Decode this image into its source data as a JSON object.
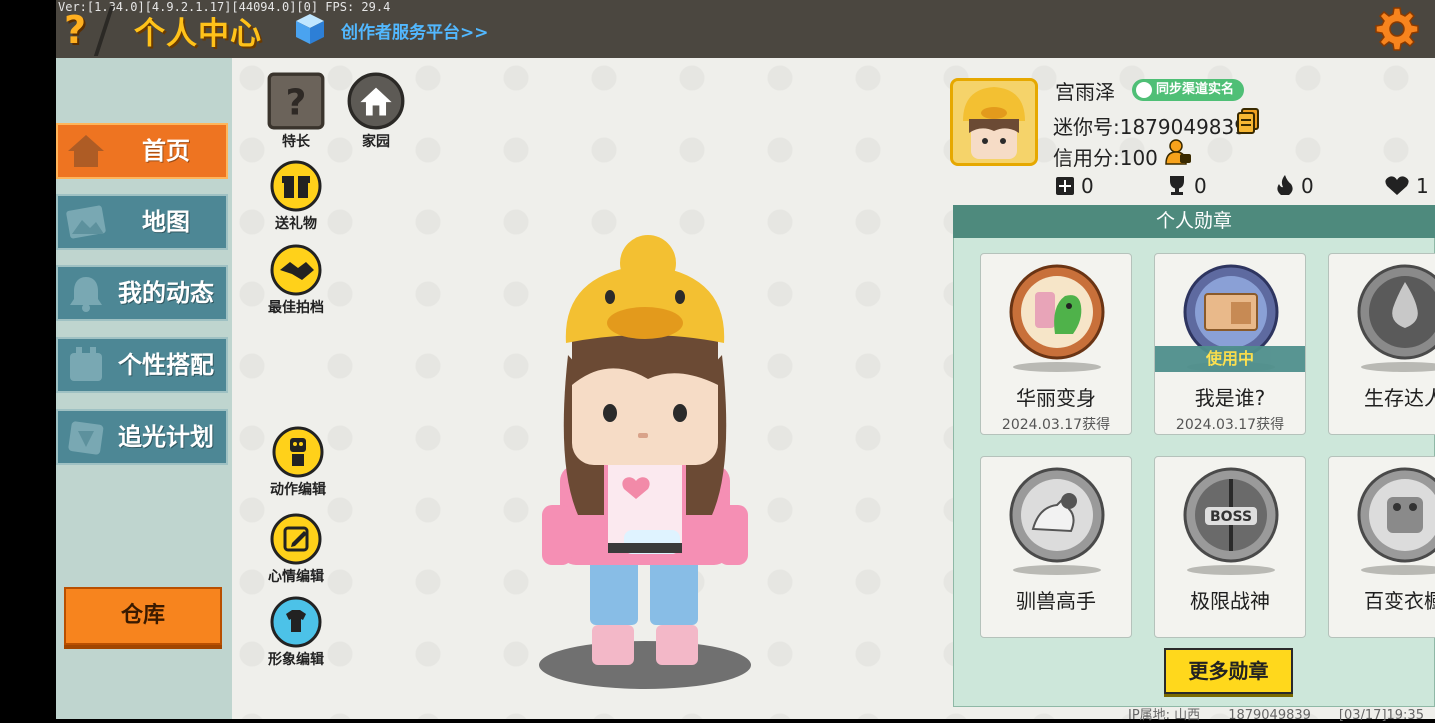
{
  "debug_text": "Ver:[1.34.0][4.9.2.1.17][44094.0][0] FPS: 29.4",
  "header": {
    "title": "个人中心",
    "creator_link": "创作者服务平台>>",
    "help_icon": "question-mark-icon",
    "settings_icon": "gear-icon"
  },
  "sidebar": {
    "items": [
      {
        "label": "首页",
        "icon": "house-icon",
        "active": true
      },
      {
        "label": "地图",
        "icon": "map-icon",
        "active": false
      },
      {
        "label": "我的动态",
        "icon": "bell-icon",
        "active": false
      },
      {
        "label": "个性搭配",
        "icon": "outfit-icon",
        "active": false
      },
      {
        "label": "追光计划",
        "icon": "light-icon",
        "active": false
      }
    ],
    "warehouse_label": "仓库"
  },
  "tools": {
    "specialty": "特长",
    "home": "家园",
    "send_gift": "送礼物",
    "best_photo": "最佳拍档",
    "action_edit": "动作编辑",
    "mood_edit": "心情编辑",
    "image_edit": "形象编辑"
  },
  "profile": {
    "name": "宫雨泽",
    "verify_badge": "同步渠道实名",
    "mini_id": "迷你号:1879049839",
    "credit": "信用分:100",
    "stats": [
      {
        "icon": "add-friend-icon",
        "value": "0"
      },
      {
        "icon": "trophy-icon",
        "value": "0"
      },
      {
        "icon": "flame-icon",
        "value": "0"
      },
      {
        "icon": "heart-icon",
        "value": "1"
      }
    ]
  },
  "medals": {
    "title": "个人勋章",
    "items": [
      {
        "name": "华丽变身",
        "date": "2024.03.17获得",
        "in_use": false,
        "icon": "dinosaur-medal-icon"
      },
      {
        "name": "我是谁?",
        "date": "2024.03.17获得",
        "in_use": true,
        "in_use_label": "使用中",
        "icon": "id-card-medal-icon"
      },
      {
        "name": "生存达人",
        "date": "",
        "in_use": false,
        "icon": "campfire-medal-icon"
      },
      {
        "name": "驯兽高手",
        "date": "",
        "in_use": false,
        "icon": "horse-medal-icon"
      },
      {
        "name": "极限战神",
        "date": "",
        "in_use": false,
        "icon": "boss-medal-icon"
      },
      {
        "name": "百变衣橱",
        "date": "",
        "in_use": false,
        "icon": "wardrobe-medal-icon"
      }
    ],
    "more_label": "更多勋章"
  },
  "footer": {
    "ip_location": "IP属地: 山西",
    "uid": "1879049839",
    "timestamp": "[03/17]19:35"
  },
  "colors": {
    "accent_orange": "#ee7421",
    "title_yellow": "#ffc21a",
    "nav_teal": "#4d8795",
    "medal_header": "#4e8a7d",
    "badge_green": "#4fbf76"
  }
}
